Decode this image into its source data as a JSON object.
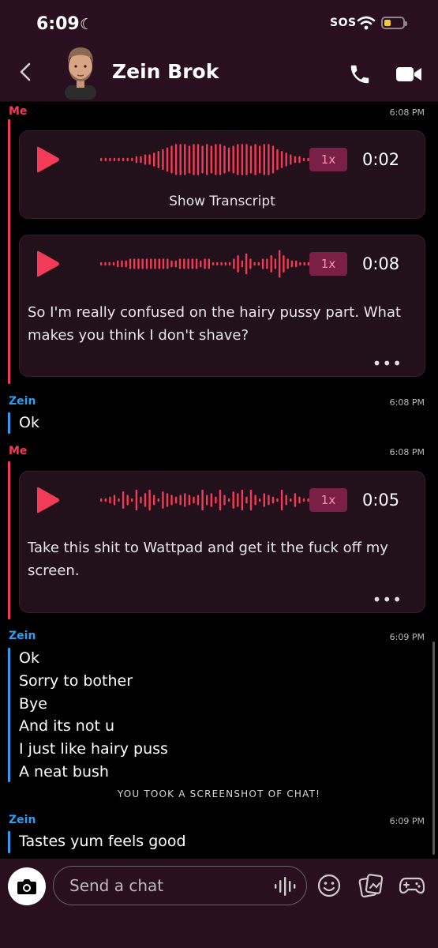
{
  "status_bar": {
    "time": "6:09",
    "sos": "SOS"
  },
  "header": {
    "contact_name": "Zein Brok"
  },
  "messages": [
    {
      "sender": "Me",
      "time": "6:08 PM",
      "voice_notes": [
        {
          "speed": "1x",
          "duration": "0:02",
          "show_transcript": "Show Transcript"
        },
        {
          "speed": "1x",
          "duration": "0:08",
          "transcript": "So I'm really confused on the hairy pussy part. What makes you think I don't shave?"
        }
      ]
    },
    {
      "sender": "Zein",
      "time": "6:08 PM",
      "lines": [
        "Ok"
      ]
    },
    {
      "sender": "Me",
      "time": "6:08 PM",
      "voice_notes": [
        {
          "speed": "1x",
          "duration": "0:05",
          "transcript": "Take this shit to Wattpad and get it the fuck off my screen."
        }
      ]
    },
    {
      "sender": "Zein",
      "time": "6:09 PM",
      "lines": [
        "Ok",
        "Sorry to bother",
        "Bye",
        "And its not u",
        "I just like hairy puss",
        "A neat bush"
      ]
    },
    {
      "sender": "Zein",
      "time": "6:09 PM",
      "lines": [
        "Tastes yum feels good"
      ]
    }
  ],
  "screenshot_notice": "YOU TOOK A SCREENSHOT OF CHAT!",
  "composer": {
    "placeholder": "Send a chat"
  },
  "colors": {
    "me": "#f23c57",
    "friend": "#2f9df0",
    "background": "#000000",
    "header": "#2a0f1e",
    "speed_badge": "#7a2047"
  },
  "icons": [
    "moon-icon",
    "wifi-icon",
    "battery-icon",
    "back-chevron-icon",
    "bitmoji-avatar",
    "phone-icon",
    "video-camera-icon",
    "play-icon",
    "waveform-icon",
    "more-dots-icon",
    "camera-icon",
    "voice-icon",
    "emoji-icon",
    "gallery-icon",
    "game-controller-icon"
  ]
}
